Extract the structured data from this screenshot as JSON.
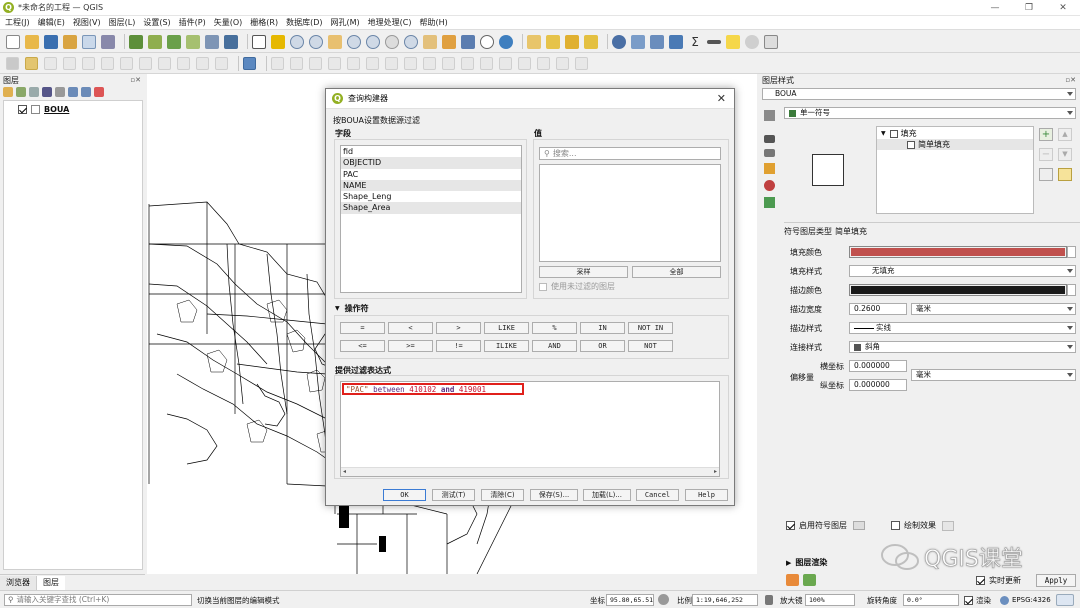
{
  "window": {
    "title": "*未命名的工程 — QGIS",
    "logo": "Q",
    "minimize": "—",
    "maximize": "❐",
    "close": "✕"
  },
  "menu": [
    "工程(J)",
    "编辑(E)",
    "视图(V)",
    "图层(L)",
    "设置(S)",
    "插件(P)",
    "矢量(O)",
    "栅格(R)",
    "数据库(D)",
    "网孔(M)",
    "地理处理(C)",
    "帮助(H)"
  ],
  "layers_panel": {
    "title": "图层",
    "layer": "BOUA",
    "tabs": [
      "浏览器",
      "图层"
    ]
  },
  "styling_panel": {
    "title": "图层样式",
    "layer": "BOUA",
    "renderer": "单一符号",
    "tree": {
      "root": "填充",
      "child": "简单填充"
    },
    "symbol_layer_type_label": "符号图层类型",
    "symbol_layer_type": "简单填充",
    "fill_color_label": "填充颜色",
    "fill_color": "#c0504d",
    "fill_style_label": "填充样式",
    "fill_style": "无填充",
    "stroke_color_label": "描边颜色",
    "stroke_color": "#1a1a1a",
    "stroke_width_label": "描边宽度",
    "stroke_width": "0.2600",
    "stroke_unit": "毫米",
    "stroke_style_label": "描边样式",
    "stroke_style": "实线",
    "join_style_label": "连接样式",
    "join_style": "斜角",
    "offset_label": "偏移量",
    "offset_x_label": "横坐标",
    "offset_x": "0.000000",
    "offset_y_label": "纵坐标",
    "offset_y": "0.000000",
    "offset_unit": "毫米",
    "enable_symbol_layer": "启用符号图层",
    "draw_effects": "绘制效果",
    "layer_render": "图层渲染",
    "live_update": "实时更新",
    "apply": "Apply"
  },
  "dialog": {
    "title": "查询构建器",
    "subtitle": "按BOUA设置数据源过滤",
    "fields_label": "字段",
    "values_label": "值",
    "fields": [
      "fid",
      "OBJECTID",
      "PAC",
      "NAME",
      "Shape_Leng",
      "Shape_Area"
    ],
    "search_placeholder": "搜索...",
    "sample_button": "采样",
    "all_button": "全部",
    "use_unfiltered": "使用未过滤的图层",
    "operators_label": "操作符",
    "operators_row1": [
      "=",
      "<",
      ">",
      "LIKE",
      "%",
      "IN",
      "NOT IN"
    ],
    "operators_row2": [
      "<=",
      ">=",
      "!=",
      "ILIKE",
      "AND",
      "OR",
      "NOT"
    ],
    "filter_label": "提供过滤表达式",
    "expr_field": "\"PAC\"",
    "expr_between": " between ",
    "expr_num1": "410102",
    "expr_and": " and ",
    "expr_num2": "419001",
    "buttons": [
      "OK",
      "测试(T)",
      "清除(C)",
      "保存(S)...",
      "加载(L)...",
      "Cancel",
      "Help"
    ]
  },
  "statusbar": {
    "search_placeholder": "请输入关键字查找 (Ctrl+K)",
    "message": "切换当前图层的编辑模式",
    "coord_label": "坐标",
    "coord": "95.80,65.51",
    "scale_label": "比例",
    "scale": "1:19,646,252",
    "magnifier_label": "放大镜",
    "magnifier": "100%",
    "rotation_label": "旋转角度",
    "rotation": "0.0°",
    "render_label": "渲染",
    "crs": "EPSG:4326"
  },
  "watermark": "QGIS课堂",
  "colors": {
    "qgis_green": "#93b023",
    "highlight_red": "#e0201b",
    "expr_field": "#a0522d",
    "expr_number": "#c8102e",
    "expr_keyword": "#5b2d82"
  }
}
